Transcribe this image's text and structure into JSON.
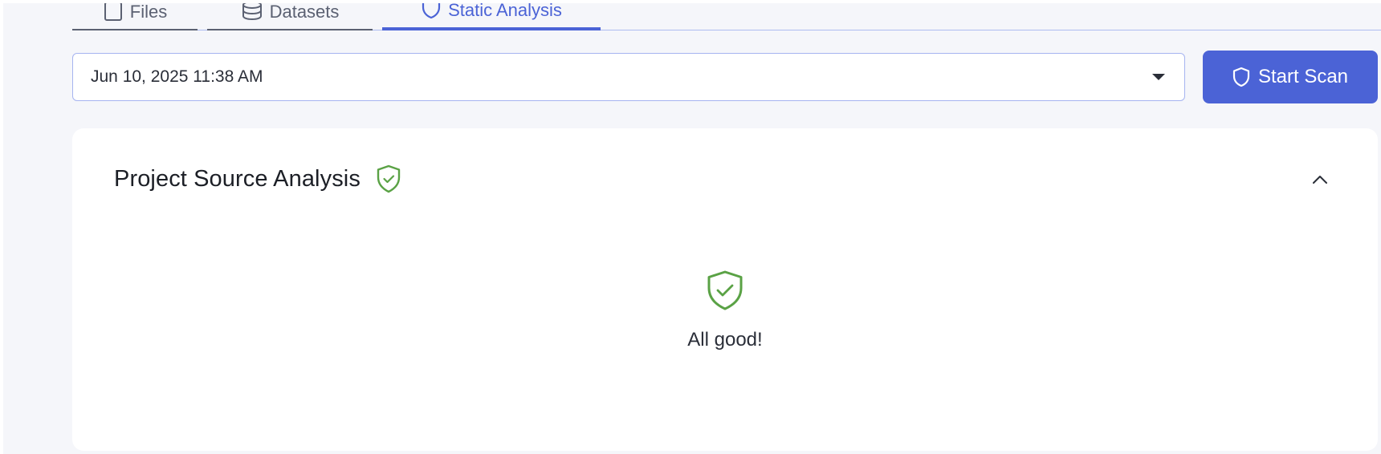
{
  "tabs": [
    {
      "label": "Files",
      "icon": "file-icon",
      "active": false
    },
    {
      "label": "Datasets",
      "icon": "database-icon",
      "active": false
    },
    {
      "label": "Static Analysis",
      "icon": "shield-icon",
      "active": true
    }
  ],
  "toolbar": {
    "selected_scan": "Jun 10, 2025 11:38 AM",
    "start_scan_label": "Start Scan"
  },
  "card": {
    "title": "Project Source Analysis",
    "status_icon": "shield-check-icon",
    "empty_message": "All good!"
  },
  "colors": {
    "accent": "#4b63d6",
    "success": "#5aa245",
    "tab_inactive": "#5b6172",
    "background": "#f5f6fa"
  }
}
